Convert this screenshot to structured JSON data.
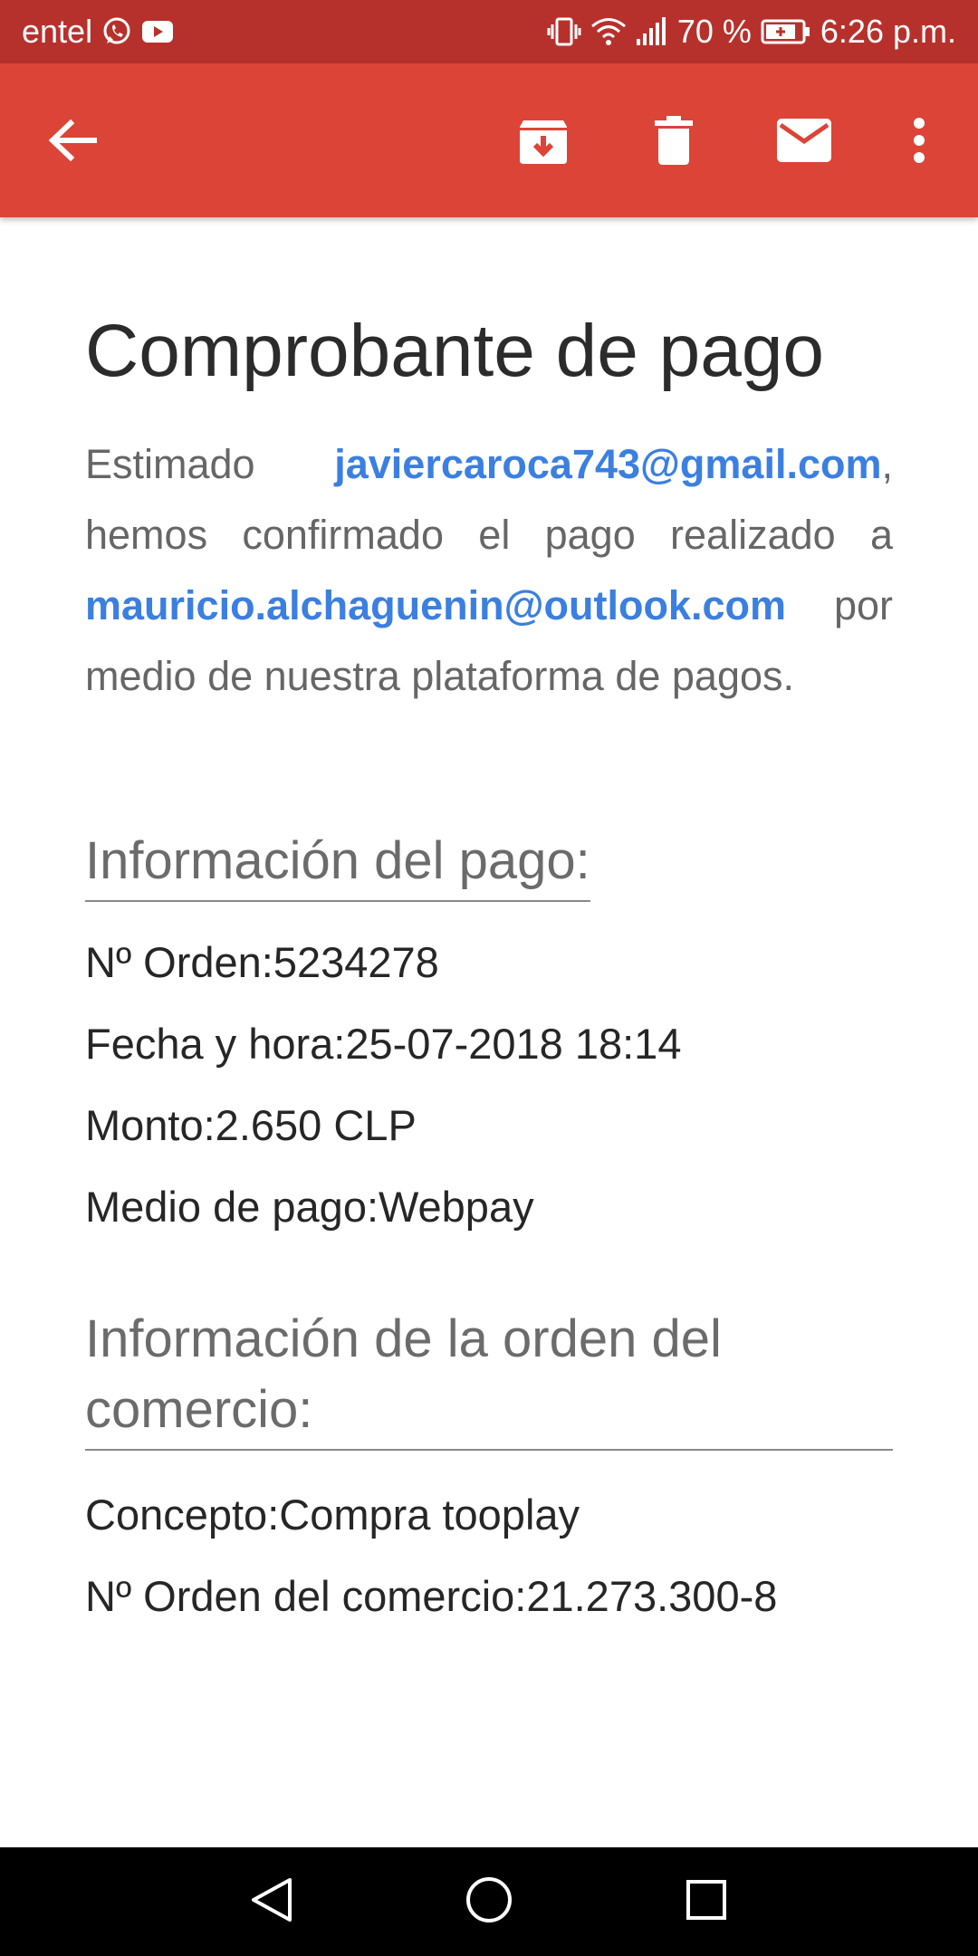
{
  "status_bar": {
    "carrier": "entel",
    "battery": "70 %",
    "time": "6:26 p.m.",
    "icons": [
      "whatsapp-icon",
      "youtube-icon",
      "vibrate-icon",
      "wifi-icon",
      "signal-icon",
      "battery-icon"
    ]
  },
  "app_bar": {
    "color": "#db4437",
    "actions": [
      "back-arrow-icon",
      "archive-icon",
      "delete-icon",
      "mark-unread-icon",
      "more-options-icon"
    ]
  },
  "email": {
    "title": "Comprobante de pago",
    "intro": {
      "greeting": "Estimado",
      "sender_email": "javiercaroca743@gmail.com",
      "mid_text": ", hemos confirmado el pago realizado a",
      "recipient_email": "mauricio.alchaguenin@outlook.com",
      "end_text": "por medio de nuestra plataforma de pagos."
    },
    "payment_section": {
      "title": "Información del pago:",
      "rows": [
        "Nº Orden:5234278",
        "Fecha y hora:25-07-2018 18:14",
        "Monto:2.650 CLP",
        "Medio de pago:Webpay"
      ]
    },
    "order_section": {
      "title": "Información de la orden del comercio:",
      "rows": [
        "Concepto:Compra tooplay",
        "Nº Orden del comercio:21.273.300-8"
      ]
    },
    "link_color": "#3b7fe0"
  },
  "nav_bar": {
    "buttons": [
      "back-triangle-icon",
      "home-circle-icon",
      "recents-square-icon"
    ]
  }
}
